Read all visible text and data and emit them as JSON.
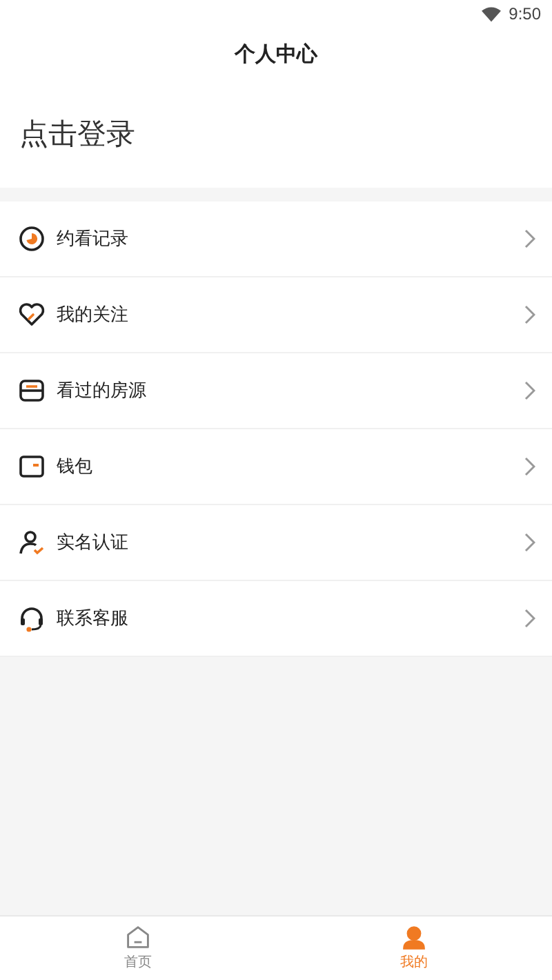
{
  "status_bar": {
    "time": "9:50"
  },
  "header": {
    "title": "个人中心"
  },
  "login": {
    "label": "点击登录"
  },
  "menu": [
    {
      "label": "约看记录"
    },
    {
      "label": "我的关注"
    },
    {
      "label": "看过的房源"
    },
    {
      "label": "钱包"
    },
    {
      "label": "实名认证"
    },
    {
      "label": "联系客服"
    }
  ],
  "tab_bar": [
    {
      "label": "首页",
      "selected": false
    },
    {
      "label": "我的",
      "selected": true
    }
  ]
}
